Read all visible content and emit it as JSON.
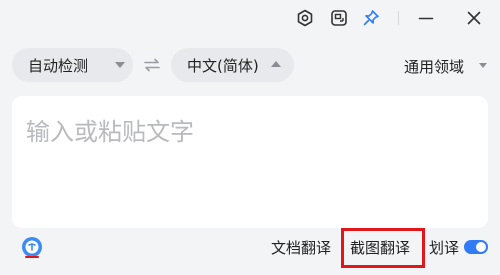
{
  "titlebar": {
    "icons": [
      "settings-icon",
      "screenshot-translate-icon",
      "pin-icon",
      "minimize-icon",
      "close-icon"
    ]
  },
  "language_bar": {
    "source_language": "自动检测",
    "target_language": "中文(简体)",
    "domain": "通用领域"
  },
  "input": {
    "placeholder": "输入或粘贴文字",
    "value": ""
  },
  "bottom_bar": {
    "doc_translate": "文档翻译",
    "screenshot_translate": "截图翻译",
    "selection_translate": "划译",
    "selection_translate_enabled": true
  },
  "colors": {
    "accent": "#2f7cf6",
    "highlight": "#e0161b",
    "background": "#f3f4f6",
    "placeholder": "#b8babe"
  }
}
